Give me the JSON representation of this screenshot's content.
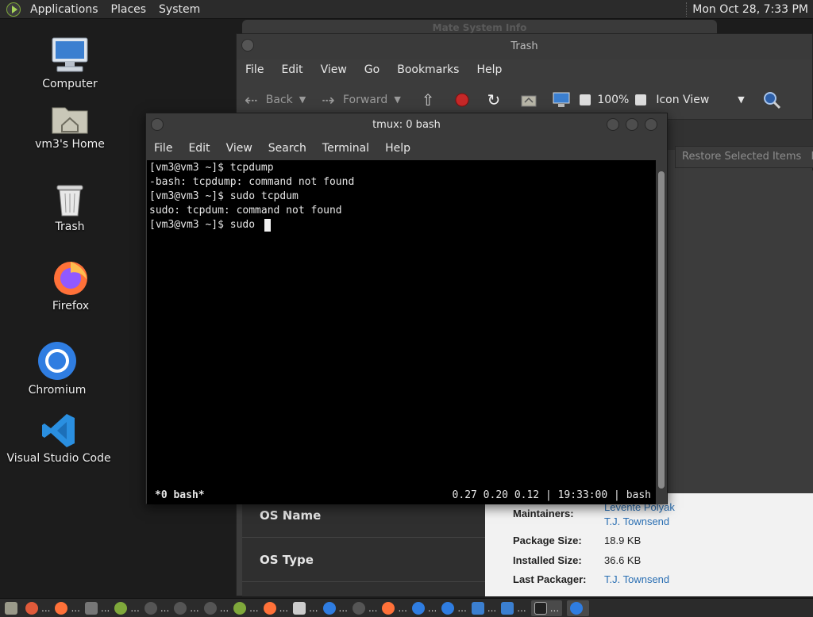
{
  "top_panel": {
    "applications": "Applications",
    "places": "Places",
    "system": "System",
    "clock": "Mon Oct 28, 7:33 PM"
  },
  "desktop": {
    "computer": "Computer",
    "home": "vm3's Home",
    "trash": "Trash",
    "firefox": "Firefox",
    "chromium": "Chromium",
    "vscode": "Visual Studio Code"
  },
  "sysinfo_window": {
    "title": "Mate System Info"
  },
  "trash_window": {
    "title": "Trash",
    "menu": [
      "File",
      "Edit",
      "View",
      "Go",
      "Bookmarks",
      "Help"
    ],
    "toolbar": {
      "back": "Back",
      "forward": "Forward",
      "zoom": "100%",
      "view_mode": "Icon View"
    },
    "restore_button": "Restore Selected Items",
    "restore_cut": "Er"
  },
  "os_info": {
    "os_name": "OS Name",
    "os_type": "OS Type"
  },
  "package_info": {
    "maintainer_top": "Levente Polyak",
    "maintainers_label": "Maintainers:",
    "maintainers_value": "T.J. Townsend",
    "package_size_label": "Package Size:",
    "package_size_value": "18.9 KB",
    "installed_size_label": "Installed Size:",
    "installed_size_value": "36.6 KB",
    "last_packager_label": "Last Packager:",
    "last_packager_value": "T.J. Townsend"
  },
  "terminal": {
    "title": "tmux: 0 bash",
    "menu": [
      "File",
      "Edit",
      "View",
      "Search",
      "Terminal",
      "Help"
    ],
    "lines": [
      "[vm3@vm3 ~]$ tcpdump",
      "-bash: tcpdump: command not found",
      "[vm3@vm3 ~]$ sudo tcpdum",
      "sudo: tcpdum: command not found",
      "[vm3@vm3 ~]$ sudo "
    ],
    "status_left": "*0 bash*",
    "status_right": "0.27 0.20 0.12 | 19:33:00 | bash"
  },
  "colors": {
    "terminal_bg": "#000000",
    "panel_bg": "#2b2b2b",
    "link": "#2a6fb3"
  }
}
